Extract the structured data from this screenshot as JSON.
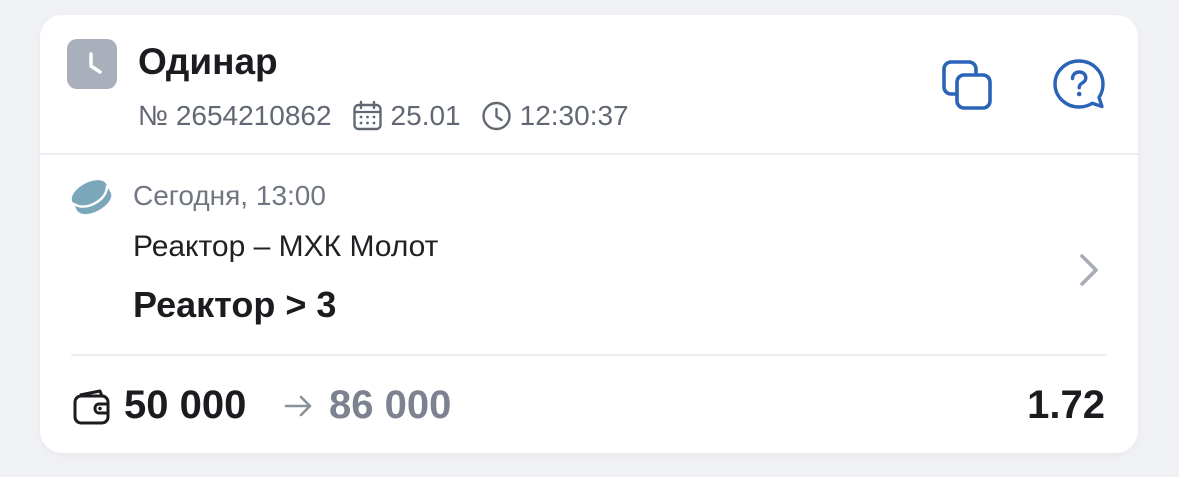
{
  "bet": {
    "type_label": "Одинар",
    "status_icon": "clock-icon",
    "number": "№ 2654210862",
    "date": "25.01",
    "time": "12:30:37"
  },
  "actions": {
    "copy_icon": "copy-icon",
    "help_icon": "help-chat-icon"
  },
  "event": {
    "sport_icon": "hockey-puck-icon",
    "start": "Сегодня, 13:00",
    "teams": "Реактор – МХК Молот",
    "selection": "Реактор > 3"
  },
  "footer": {
    "stake": "50 000",
    "payout": "86 000",
    "odds": "1.72"
  },
  "colors": {
    "accent": "#2b63b8",
    "puck": "#7aa7b9",
    "status_tile": "#a9b0bb",
    "muted_text": "#7c8290"
  }
}
